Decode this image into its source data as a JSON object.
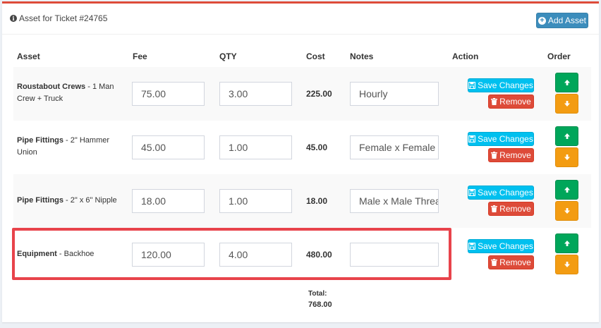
{
  "header": {
    "title": "Asset for Ticket #24765",
    "add_button": "Add Asset"
  },
  "columns": {
    "asset": "Asset",
    "fee": "Fee",
    "qty": "QTY",
    "cost": "Cost",
    "notes": "Notes",
    "action": "Action",
    "order": "Order"
  },
  "rows": [
    {
      "name": "Roustabout Crews",
      "detail": " - 1 Man Crew + Truck",
      "fee": "75.00",
      "qty": "3.00",
      "cost": "225.00",
      "notes": "Hourly",
      "notes_placeholder": ""
    },
    {
      "name": "Pipe Fittings",
      "detail": " - 2\" Hammer Union",
      "fee": "45.00",
      "qty": "1.00",
      "cost": "45.00",
      "notes": "Female x Female",
      "notes_placeholder": ""
    },
    {
      "name": "Pipe Fittings",
      "detail": " - 2\" x 6\" Nipple",
      "fee": "18.00",
      "qty": "1.00",
      "cost": "18.00",
      "notes": "Male x Male Threaded",
      "notes_placeholder": ""
    },
    {
      "name": "Equipment",
      "detail": " - Backhoe",
      "fee": "120.00",
      "qty": "4.00",
      "cost": "480.00",
      "notes": "",
      "notes_placeholder": ""
    }
  ],
  "buttons": {
    "save": "Save Changes",
    "remove": "Remove"
  },
  "icons": {
    "info": "info-icon",
    "add": "plus-circle-icon",
    "save": "floppy-disk-icon",
    "remove": "trash-icon",
    "up": "arrow-up-icon",
    "down": "arrow-down-icon"
  },
  "total": {
    "label": "Total:",
    "value": "768.00"
  },
  "colors": {
    "panel_top": "#dd4b39",
    "primary": "#3c8dbc",
    "info": "#00c0ef",
    "danger": "#dd4b39",
    "success": "#00a65a",
    "warning": "#f39c12",
    "highlight": "#e8434b"
  }
}
